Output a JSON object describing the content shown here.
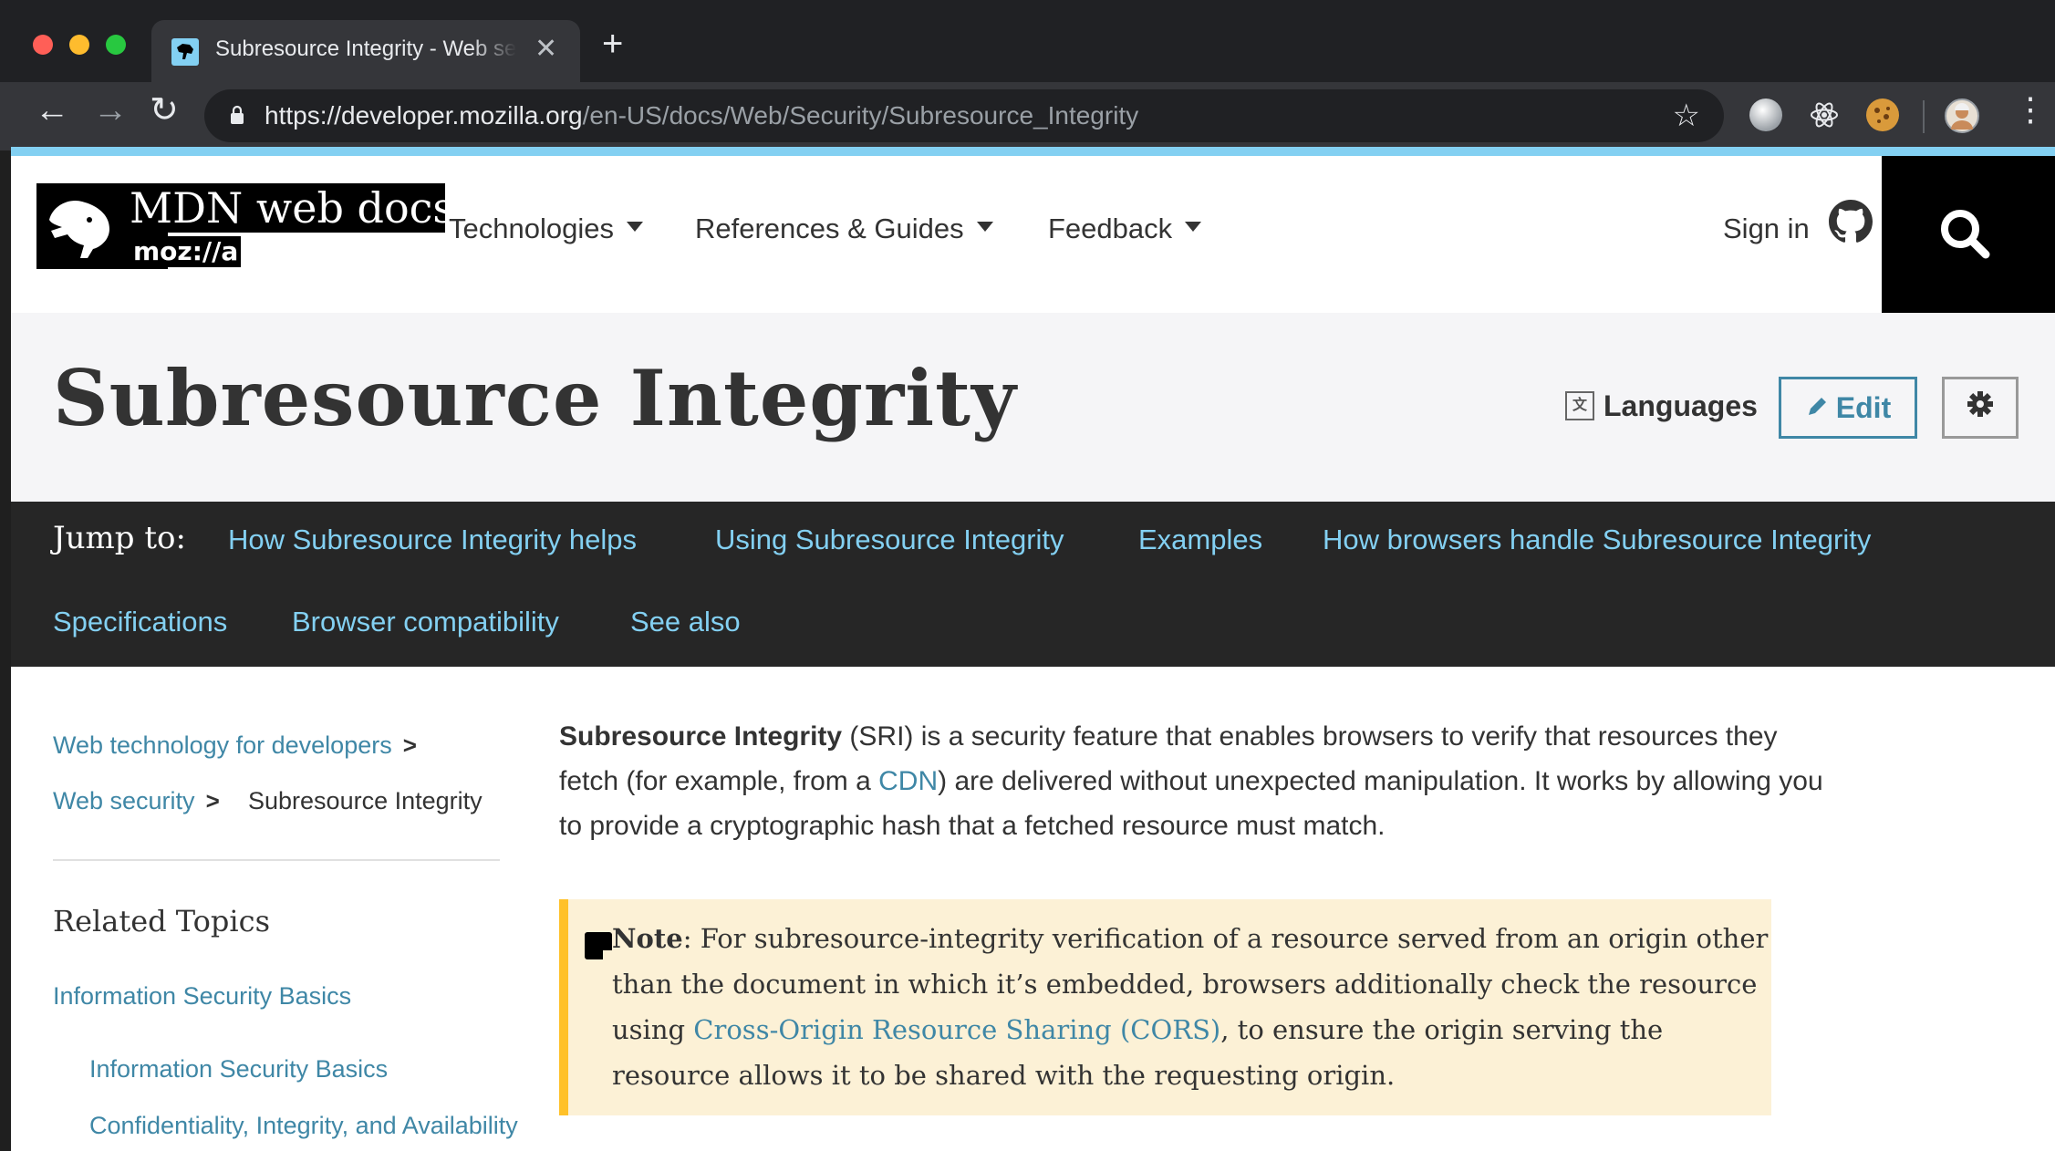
{
  "browser": {
    "tab_title": "Subresource Integrity - Web security | MDN",
    "new_tab_glyph": "+",
    "close_glyph": "✕",
    "back_glyph": "←",
    "forward_glyph": "→",
    "reload_glyph": "↻",
    "url_host": "https://developer.mozilla.org",
    "url_path": "/en-US/docs/Web/Security/Subresource_Integrity",
    "star_glyph": "☆",
    "menu_glyph": "⋮",
    "traffic_colors": [
      "#ff5f57",
      "#febc2e",
      "#28c840"
    ]
  },
  "header": {
    "logo_text": "MDN web docs",
    "logo_sub": "moz://a",
    "nav": [
      "Technologies",
      "References & Guides",
      "Feedback"
    ],
    "sign_in": "Sign in"
  },
  "title_bar": {
    "title": "Subresource Integrity",
    "languages": "Languages",
    "edit": "Edit"
  },
  "jump": {
    "label": "Jump to:",
    "links": [
      "How Subresource Integrity helps",
      "Using Subresource Integrity",
      "Examples",
      "How browsers handle Subresource Integrity",
      "Specifications",
      "Browser compatibility",
      "See also"
    ]
  },
  "sidebar": {
    "breadcrumbs": [
      "Web technology for developers",
      "Web security",
      "Subresource Integrity"
    ],
    "related_heading": "Related Topics",
    "links": [
      "Information Security Basics",
      "Information Security Basics",
      "Confidentiality, Integrity, and Availability"
    ]
  },
  "article": {
    "intro_strong": "Subresource Integrity",
    "intro_1": " (SRI) is a security feature that enables browsers to verify that resources they fetch (for example, from a ",
    "intro_link": "CDN",
    "intro_2": ") are delivered without unexpected manipulation. It works by allowing you to provide a cryptographic hash that a fetched resource must match.",
    "note_label": "Note",
    "note_1": ": For subresource-integrity verification of a resource served from an origin other than the document in which it’s embedded, browsers additionally check the resource using ",
    "note_link": "Cross-Origin Resource Sharing (CORS)",
    "note_2": ", to ensure the origin serving the resource allows it to be shared with the requesting origin."
  },
  "colors": {
    "link": "#3f87a6",
    "jump_link": "#83d0f2",
    "note_bg": "#fcf1d6",
    "note_border": "#ffc129",
    "accent": "#83d0f2"
  }
}
